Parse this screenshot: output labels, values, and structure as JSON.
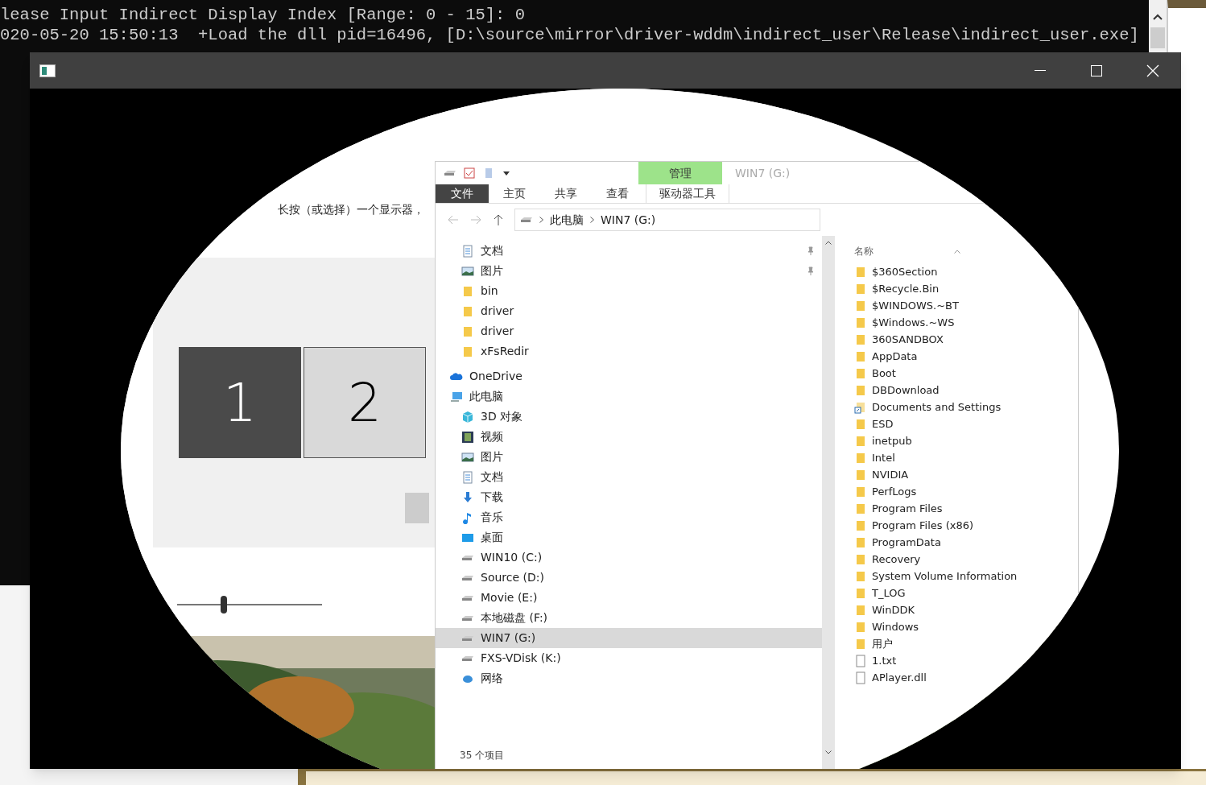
{
  "console": {
    "lines": [
      "lease Input Indirect Display Index [Range: 0 - 15]: 0",
      "020-05-20 15:50:13  +Load the dll pid=16496, [D:\\source\\mirror\\driver-wddm\\indirect_user\\Release\\indirect_user.exe]"
    ]
  },
  "display_settings": {
    "instruction": "长按（或选择）一个显示器，",
    "displays": [
      {
        "label": "1",
        "selected": true
      },
      {
        "label": "2",
        "selected": false
      }
    ],
    "brightness": {
      "level": 0.3
    }
  },
  "explorer": {
    "context_group": "管理",
    "title": "WIN7 (G:)",
    "ribbon_tabs": [
      {
        "label": "文件",
        "kind": "file"
      },
      {
        "label": "主页",
        "kind": "tab"
      },
      {
        "label": "共享",
        "kind": "tab"
      },
      {
        "label": "查看",
        "kind": "tab"
      },
      {
        "label": "驱动器工具",
        "kind": "context"
      }
    ],
    "breadcrumb": [
      "此电脑",
      "WIN7 (G:)"
    ],
    "nav_items": [
      {
        "label": "文档",
        "kind": "document",
        "pinned": true,
        "selected": false
      },
      {
        "label": "图片",
        "kind": "picture",
        "pinned": true,
        "selected": false
      },
      {
        "label": "bin",
        "kind": "folder",
        "pinned": false,
        "selected": false
      },
      {
        "label": "driver",
        "kind": "folder",
        "pinned": false,
        "selected": false
      },
      {
        "label": "driver",
        "kind": "folder",
        "pinned": false,
        "selected": false
      },
      {
        "label": "xFsRedir",
        "kind": "folder",
        "pinned": false,
        "selected": false
      },
      {
        "label": "OneDrive",
        "kind": "cloud",
        "pinned": false,
        "selected": false
      },
      {
        "label": "此电脑",
        "kind": "computer",
        "pinned": false,
        "selected": false
      },
      {
        "label": "3D 对象",
        "kind": "cube",
        "pinned": false,
        "selected": false
      },
      {
        "label": "视频",
        "kind": "video",
        "pinned": false,
        "selected": false
      },
      {
        "label": "图片",
        "kind": "picture",
        "pinned": false,
        "selected": false
      },
      {
        "label": "文档",
        "kind": "document",
        "pinned": false,
        "selected": false
      },
      {
        "label": "下载",
        "kind": "download",
        "pinned": false,
        "selected": false
      },
      {
        "label": "音乐",
        "kind": "music",
        "pinned": false,
        "selected": false
      },
      {
        "label": "桌面",
        "kind": "desktop",
        "pinned": false,
        "selected": false
      },
      {
        "label": "WIN10 (C:)",
        "kind": "drive",
        "pinned": false,
        "selected": false
      },
      {
        "label": "Source (D:)",
        "kind": "drive",
        "pinned": false,
        "selected": false
      },
      {
        "label": "Movie (E:)",
        "kind": "drive",
        "pinned": false,
        "selected": false
      },
      {
        "label": "本地磁盘 (F:)",
        "kind": "drive",
        "pinned": false,
        "selected": false
      },
      {
        "label": "WIN7 (G:)",
        "kind": "drive",
        "pinned": false,
        "selected": true
      },
      {
        "label": "FXS-VDisk (K:)",
        "kind": "drive",
        "pinned": false,
        "selected": false
      },
      {
        "label": "网络",
        "kind": "network",
        "pinned": false,
        "selected": false
      }
    ],
    "column_header": "名称",
    "files": [
      {
        "name": "$360Section",
        "kind": "folder"
      },
      {
        "name": "$Recycle.Bin",
        "kind": "folder"
      },
      {
        "name": "$WINDOWS.~BT",
        "kind": "folder"
      },
      {
        "name": "$Windows.~WS",
        "kind": "folder"
      },
      {
        "name": "360SANDBOX",
        "kind": "folder"
      },
      {
        "name": "AppData",
        "kind": "folder"
      },
      {
        "name": "Boot",
        "kind": "folder"
      },
      {
        "name": "DBDownload",
        "kind": "folder"
      },
      {
        "name": "Documents and Settings",
        "kind": "shortcut"
      },
      {
        "name": "ESD",
        "kind": "folder"
      },
      {
        "name": "inetpub",
        "kind": "folder"
      },
      {
        "name": "Intel",
        "kind": "folder"
      },
      {
        "name": "NVIDIA",
        "kind": "folder"
      },
      {
        "name": "PerfLogs",
        "kind": "folder"
      },
      {
        "name": "Program Files",
        "kind": "folder"
      },
      {
        "name": "Program Files (x86)",
        "kind": "folder"
      },
      {
        "name": "ProgramData",
        "kind": "folder"
      },
      {
        "name": "Recovery",
        "kind": "folder"
      },
      {
        "name": "System Volume Information",
        "kind": "folder"
      },
      {
        "name": "T_LOG",
        "kind": "folder"
      },
      {
        "name": "WinDDK",
        "kind": "folder"
      },
      {
        "name": "Windows",
        "kind": "folder"
      },
      {
        "name": "用户",
        "kind": "folder"
      },
      {
        "name": "1.txt",
        "kind": "file"
      },
      {
        "name": "APlayer.dll",
        "kind": "file"
      }
    ],
    "status": "35 个项目"
  }
}
